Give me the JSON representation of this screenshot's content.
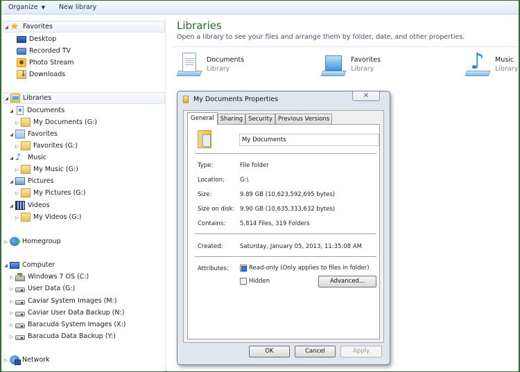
{
  "toolbar": {
    "organize_label": "Organize",
    "new_library_label": "New library"
  },
  "sidebar": {
    "favorites": {
      "label": "Favorites",
      "items": [
        {
          "label": "Desktop",
          "icon": "desktop-icon"
        },
        {
          "label": "Recorded TV",
          "icon": "tv-icon"
        },
        {
          "label": "Photo Stream",
          "icon": "photo-stream-icon"
        },
        {
          "label": "Downloads",
          "icon": "downloads-icon"
        }
      ]
    },
    "libraries": {
      "label": "Libraries",
      "items": [
        {
          "label": "Documents",
          "child": "My Documents (G:)"
        },
        {
          "label": "Favorites",
          "child": "Favorites (G:)"
        },
        {
          "label": "Music",
          "child": "My Music (G:)"
        },
        {
          "label": "Pictures",
          "child": "My Pictures (G:)"
        },
        {
          "label": "Videos",
          "child": "My Videos (G:)"
        }
      ]
    },
    "homegroup": {
      "label": "Homegroup"
    },
    "computer": {
      "label": "Computer",
      "drives": [
        "Windows 7 OS (C:)",
        "User Data (G:)",
        "Caviar System Images (M:)",
        "Caviar User Data Backup (N:)",
        "Baracuda System Images (X:)",
        "Baracuda Data Backup (Y:)"
      ]
    },
    "network": {
      "label": "Network"
    }
  },
  "main": {
    "title": "Libraries",
    "subtitle": "Open a library to see your files and arrange them by folder, date, and other properties.",
    "tiles": [
      {
        "name": "Documents",
        "kind": "Library"
      },
      {
        "name": "Favorites",
        "kind": "Library"
      },
      {
        "name": "Music",
        "kind": "Library"
      }
    ]
  },
  "dialog": {
    "title": "My Documents Properties",
    "close_glyph": "✕",
    "tabs": [
      "General",
      "Sharing",
      "Security",
      "Previous Versions"
    ],
    "active_tab": "General",
    "name_value": "My Documents",
    "props": {
      "type_label": "Type:",
      "type_value": "File folder",
      "location_label": "Location:",
      "location_value": "G:\\",
      "size_label": "Size:",
      "size_value": "9.89 GB (10,623,592,695 bytes)",
      "size_on_disk_label": "Size on disk:",
      "size_on_disk_value": "9.90 GB (10,635,333,632 bytes)",
      "contains_label": "Contains:",
      "contains_value": "5,814 Files, 319 Folders",
      "created_label": "Created:",
      "created_value": "Saturday, January 05, 2013, 11:35:08 AM",
      "attributes_label": "Attributes:"
    },
    "attributes": {
      "readonly_label": "Read-only (Only applies to files in folder)",
      "readonly_checked": true,
      "hidden_label": "Hidden",
      "hidden_checked": false,
      "advanced_label": "Advanced..."
    },
    "buttons": {
      "ok": "OK",
      "cancel": "Cancel",
      "apply": "Apply"
    }
  }
}
